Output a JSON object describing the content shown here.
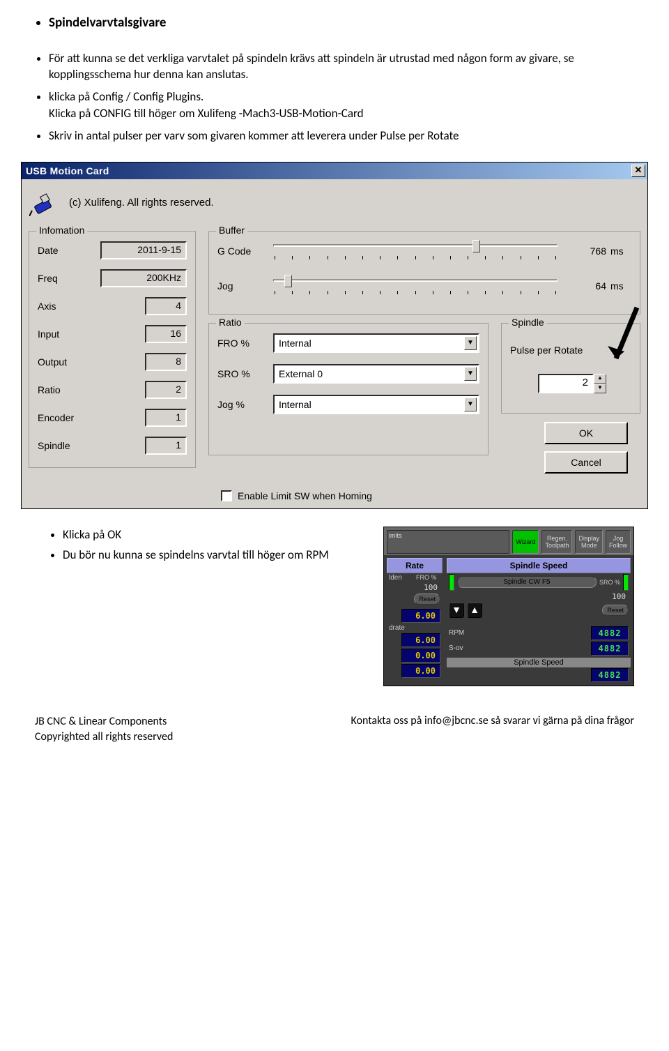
{
  "heading": "Spindelvarvtalsgivare",
  "bullets": [
    "För att kunna se det verkliga varvtalet på spindeln krävs att spindeln är utrustad med någon form av givare, se kopplingsschema hur denna kan anslutas.",
    "klicka på Config / Config Plugins.\nKlicka på CONFIG till höger om Xulifeng -Mach3-USB-Motion-Card",
    "Skriv in antal pulser per varv som givaren kommer att leverera under Pulse per Rotate"
  ],
  "dialog": {
    "title": "USB Motion Card",
    "copyright": "(c) Xulifeng.  All rights reserved.",
    "info_legend": "Infomation",
    "info": {
      "date_label": "Date",
      "date_val": "2011-9-15",
      "freq_label": "Freq",
      "freq_val": "200KHz",
      "axis_label": "Axis",
      "axis_val": "4",
      "input_label": "Input",
      "input_val": "16",
      "output_label": "Output",
      "output_val": "8",
      "ratio_label": "Ratio",
      "ratio_val": "2",
      "encoder_label": "Encoder",
      "encoder_val": "1",
      "spindle_label": "Spindle",
      "spindle_val": "1"
    },
    "buffer_legend": "Buffer",
    "buffer": {
      "gcode_label": "G Code",
      "gcode_val": "768",
      "gcode_unit": "ms",
      "jog_label": "Jog",
      "jog_val": "64",
      "jog_unit": "ms"
    },
    "ratio_legend": "Ratio",
    "ratio": {
      "fro_label": "FRO %",
      "fro_val": "Internal",
      "sro_label": "SRO %",
      "sro_val": "External 0",
      "jog_label": "Jog %",
      "jog_val": "Internal"
    },
    "limit_checkbox_label": "Enable Limit SW when Homing",
    "spindle_legend": "Spindle",
    "spindle": {
      "ppr_label": "Pulse per Rotate",
      "ppr_val": "2"
    },
    "ok": "OK",
    "cancel": "Cancel"
  },
  "below": {
    "bullets": [
      "Klicka på OK",
      "Du bör nu kunna se spindelns varvtal till höger om RPM"
    ],
    "rpm_bold": "RPM"
  },
  "mach": {
    "top_buttons": {
      "imits": "imits",
      "wizard": "Wizard",
      "regen1": "Regen.",
      "regen2": "Toolpath",
      "display1": "Display",
      "display2": "Mode",
      "jogf1": "Jog",
      "jogf2": "Follow"
    },
    "rate_header": "Rate",
    "spindle_header": "Spindle Speed",
    "left": {
      "lden": "lden",
      "fro_label": "FRO %",
      "fro_val": "100",
      "reset": "Reset",
      "n1": "6.00",
      "drate": "drate",
      "n2": "6.00",
      "n3": "0.00",
      "n4": "0.00"
    },
    "right": {
      "spindle_cw": "Spindle CW F5",
      "sro_label": "SRO %",
      "sro_val": "100",
      "reset": "Reset",
      "rpm_label": "RPM",
      "rpm_val": "4882",
      "sov_label": "S-ov",
      "sov_val": "4882",
      "ss_label": "Spindle Speed",
      "ss_val": "4882"
    }
  },
  "footer": {
    "left1": "JB CNC & Linear Components",
    "left2": "Copyrighted all rights reserved",
    "right": "Kontakta oss på info@jbcnc.se så svarar vi gärna på dina frågor"
  }
}
